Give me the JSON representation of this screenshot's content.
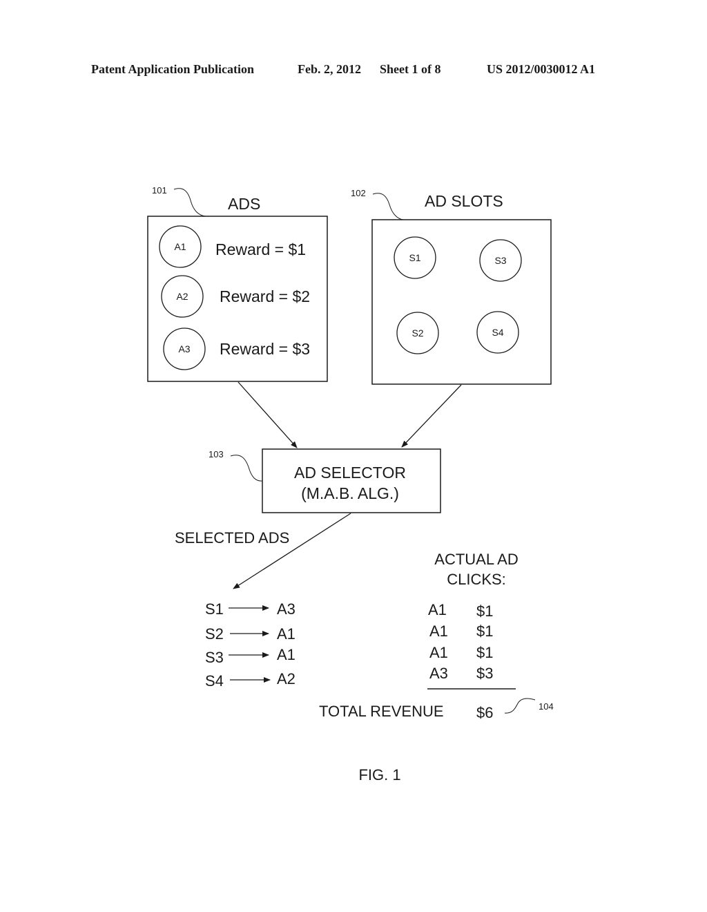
{
  "header": {
    "publication": "Patent Application Publication",
    "date": "Feb. 2, 2012",
    "sheet": "Sheet 1 of 8",
    "number": "US 2012/0030012 A1"
  },
  "ads_box": {
    "ref": "101",
    "title": "ADS",
    "items": [
      {
        "id": "A1",
        "reward": "Reward = $1"
      },
      {
        "id": "A2",
        "reward": "Reward = $2"
      },
      {
        "id": "A3",
        "reward": "Reward = $3"
      }
    ]
  },
  "slots_box": {
    "ref": "102",
    "title": "AD SLOTS",
    "slots": [
      "S1",
      "S3",
      "S2",
      "S4"
    ]
  },
  "selector": {
    "ref": "103",
    "line1": "AD SELECTOR",
    "line2": "(M.A.B. ALG.)"
  },
  "selected": {
    "label": "SELECTED ADS",
    "mappings": [
      {
        "slot": "S1",
        "ad": "A3"
      },
      {
        "slot": "S2",
        "ad": "A1"
      },
      {
        "slot": "S3",
        "ad": "A1"
      },
      {
        "slot": "S4",
        "ad": "A2"
      }
    ]
  },
  "clicks": {
    "title_line1": "ACTUAL AD",
    "title_line2": "CLICKS:",
    "rows": [
      {
        "ad": "A1",
        "value": "$1"
      },
      {
        "ad": "A1",
        "value": "$1"
      },
      {
        "ad": "A1",
        "value": "$1"
      },
      {
        "ad": "A3",
        "value": "$3"
      }
    ],
    "total_label": "TOTAL REVENUE",
    "total_value": "$6",
    "ref": "104"
  },
  "figure_label": "FIG. 1"
}
